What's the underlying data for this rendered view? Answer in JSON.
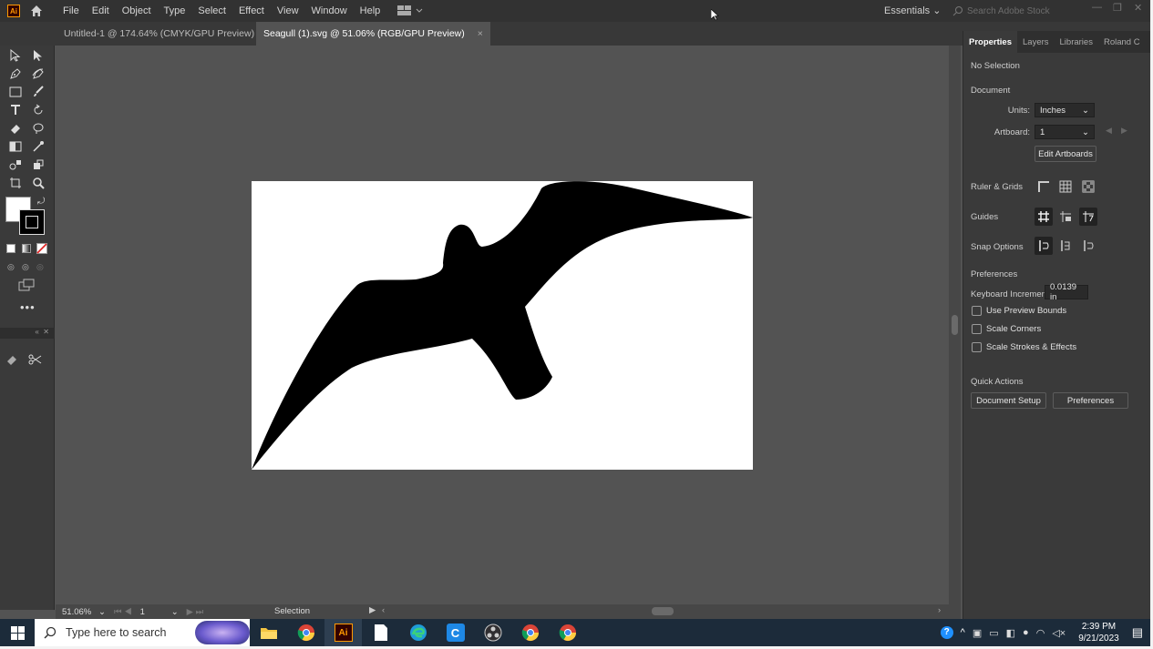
{
  "menubar": {
    "items": [
      "File",
      "Edit",
      "Object",
      "Type",
      "Select",
      "Effect",
      "View",
      "Window",
      "Help"
    ],
    "workspace": "Essentials",
    "search_placeholder": "Search Adobe Stock"
  },
  "tabs": [
    {
      "label": "Untitled-1 @ 174.64% (CMYK/GPU Preview)",
      "close": "×"
    },
    {
      "label": "Seagull (1).svg @ 51.06% (RGB/GPU Preview)",
      "close": "×"
    }
  ],
  "status": {
    "zoom": "51.06%",
    "page": "1",
    "tool": "Selection"
  },
  "panel": {
    "tabs": [
      "Properties",
      "Layers",
      "Libraries",
      "Roland C"
    ],
    "no_selection": "No Selection",
    "document_heading": "Document",
    "units_label": "Units:",
    "units_value": "Inches",
    "artboard_label": "Artboard:",
    "artboard_value": "1",
    "edit_artboards": "Edit Artboards",
    "ruler_grids": "Ruler & Grids",
    "guides": "Guides",
    "snap_options": "Snap Options",
    "preferences_heading": "Preferences",
    "keyboard_increment_label": "Keyboard Increment:",
    "keyboard_increment_value": "0.0139 in",
    "checkboxes": [
      "Use Preview Bounds",
      "Scale Corners",
      "Scale Strokes & Effects"
    ],
    "quick_actions": "Quick Actions",
    "document_setup": "Document Setup",
    "preferences_button": "Preferences"
  },
  "taskbar": {
    "search_placeholder": "Type here to search",
    "time": "2:39 PM",
    "date": "9/21/2023"
  },
  "colors": {
    "app_bg": "#535353",
    "panel_bg": "#3a3a3a",
    "menubar_bg": "#323232",
    "taskbar_bg": "#1c2b3a",
    "illustrator_orange": "#ff9a00"
  }
}
